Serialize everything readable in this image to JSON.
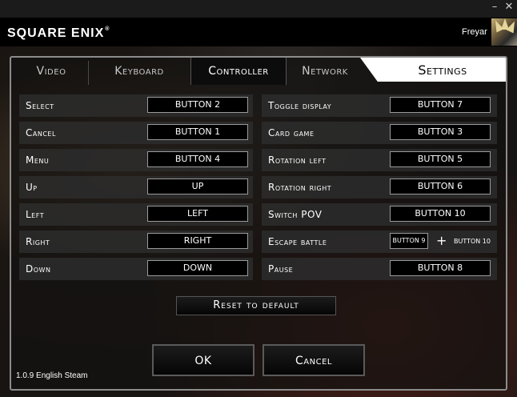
{
  "window": {
    "minimize_glyph": "–",
    "close_glyph": "✕"
  },
  "header": {
    "logo": "SQUARE ENIX",
    "logo_mark": "®",
    "username": "Freyar",
    "avatar_icon": "user-avatar-icon"
  },
  "tabs": [
    {
      "label": "Video"
    },
    {
      "label": "Keyboard"
    },
    {
      "label": "Controller",
      "active": true
    },
    {
      "label": "Network"
    },
    {
      "label": "Settings"
    }
  ],
  "left_bindings": [
    {
      "action": "Select",
      "button": "BUTTON 2"
    },
    {
      "action": "Cancel",
      "button": "BUTTON 1"
    },
    {
      "action": "Menu",
      "button": "BUTTON 4"
    },
    {
      "action": "Up",
      "button": "UP"
    },
    {
      "action": "Left",
      "button": "LEFT"
    },
    {
      "action": "Right",
      "button": "RIGHT"
    },
    {
      "action": "Down",
      "button": "DOWN"
    }
  ],
  "right_bindings": [
    {
      "action": "Toggle display",
      "button": "BUTTON 7"
    },
    {
      "action": "Card game",
      "button": "BUTTON 3"
    },
    {
      "action": "Rotation left",
      "button": "BUTTON 5"
    },
    {
      "action": "Rotation right",
      "button": "BUTTON 6"
    },
    {
      "action": "Switch POV",
      "button": "BUTTON 10"
    },
    {
      "action": "Escape battle",
      "button": "BUTTON 9",
      "plus": "+",
      "button2": "BUTTON 10"
    },
    {
      "action": "Pause",
      "button": "BUTTON 8"
    }
  ],
  "buttons": {
    "reset": "Reset to default",
    "ok": "OK",
    "cancel": "Cancel"
  },
  "version": "1.0.9 English Steam",
  "colors": {
    "accent_tab_bg": "#ffffff",
    "panel_border": "#8c8c8c",
    "row_bg": "#2d2d2d"
  }
}
